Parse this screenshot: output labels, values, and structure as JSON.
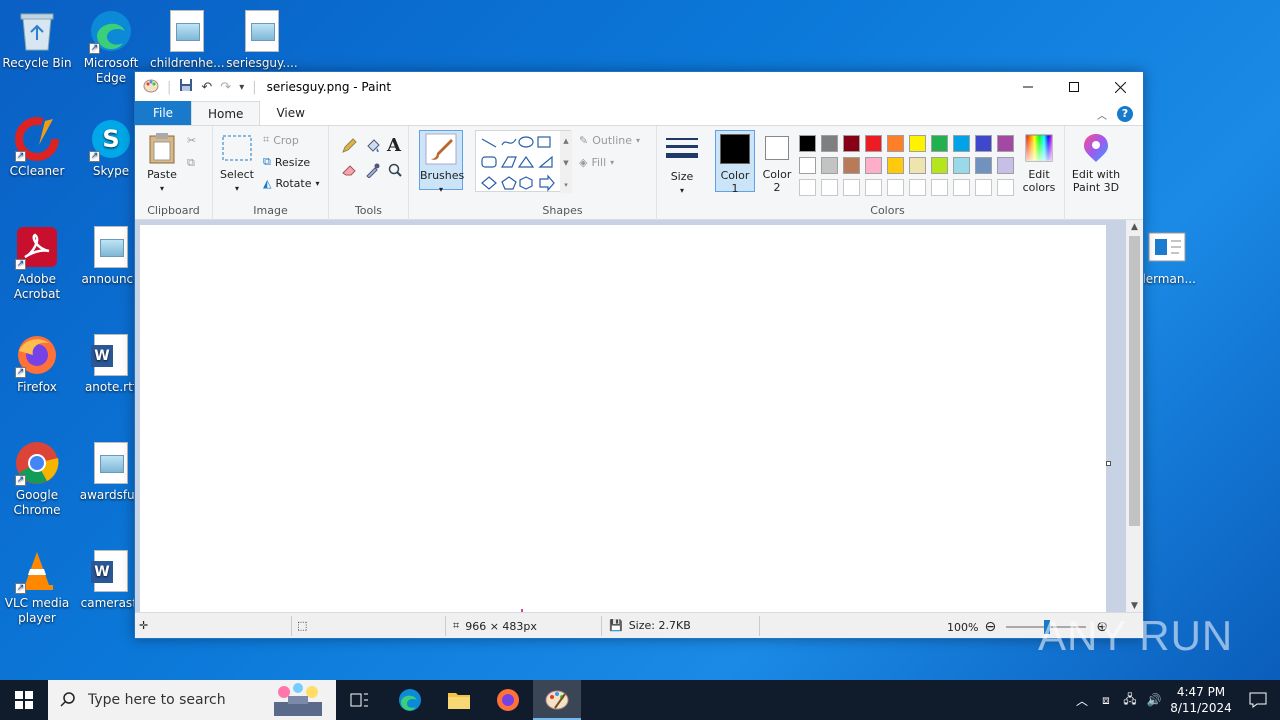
{
  "desktop": {
    "icons": [
      {
        "label": "Recycle Bin"
      },
      {
        "label": "Microsoft Edge"
      },
      {
        "label": "childrenhe..."
      },
      {
        "label": "seriesguy...."
      },
      {
        "label": "CCleaner"
      },
      {
        "label": "Skype"
      },
      {
        "label": "Adobe Acrobat"
      },
      {
        "label": "announce"
      },
      {
        "label": "Firefox"
      },
      {
        "label": "anote.rtf"
      },
      {
        "label": "Google Chrome"
      },
      {
        "label": "awardsfun"
      },
      {
        "label": "VLC media player"
      },
      {
        "label": "camerasfr"
      },
      {
        "label": "derman..."
      }
    ]
  },
  "paint": {
    "title": "seriesguy.png - Paint",
    "tabs": [
      "File",
      "Home",
      "View"
    ],
    "clipboard": {
      "paste": "Paste",
      "group": "Clipboard"
    },
    "image": {
      "select": "Select",
      "crop": "Crop",
      "resize": "Resize",
      "rotate": "Rotate",
      "group": "Image"
    },
    "tools": {
      "group": "Tools"
    },
    "brushes": "Brushes",
    "shapes": {
      "outline": "Outline",
      "fill": "Fill",
      "group": "Shapes"
    },
    "size": "Size",
    "color1": "Color 1",
    "color2": "Color 2",
    "colors_group": "Colors",
    "edit_colors": "Edit colors",
    "edit_paint3d": "Edit with Paint 3D",
    "palette_row1": [
      "#000000",
      "#7f7f7f",
      "#880015",
      "#ed1c24",
      "#ff7f27",
      "#fff200",
      "#22b14c",
      "#00a2e8",
      "#3f48cc",
      "#a349a4"
    ],
    "palette_row2": [
      "#ffffff",
      "#c3c3c3",
      "#b97a57",
      "#ffaec9",
      "#ffc90e",
      "#efe4b0",
      "#b5e61d",
      "#99d9ea",
      "#7092be",
      "#c8bfe7"
    ],
    "status": {
      "dimensions": "966 × 483px",
      "size": "Size: 2.7KB",
      "zoom": "100%"
    }
  },
  "taskbar": {
    "search_placeholder": "Type here to search",
    "time": "4:47 PM",
    "date": "8/11/2024"
  },
  "watermark": "ANY RUN"
}
